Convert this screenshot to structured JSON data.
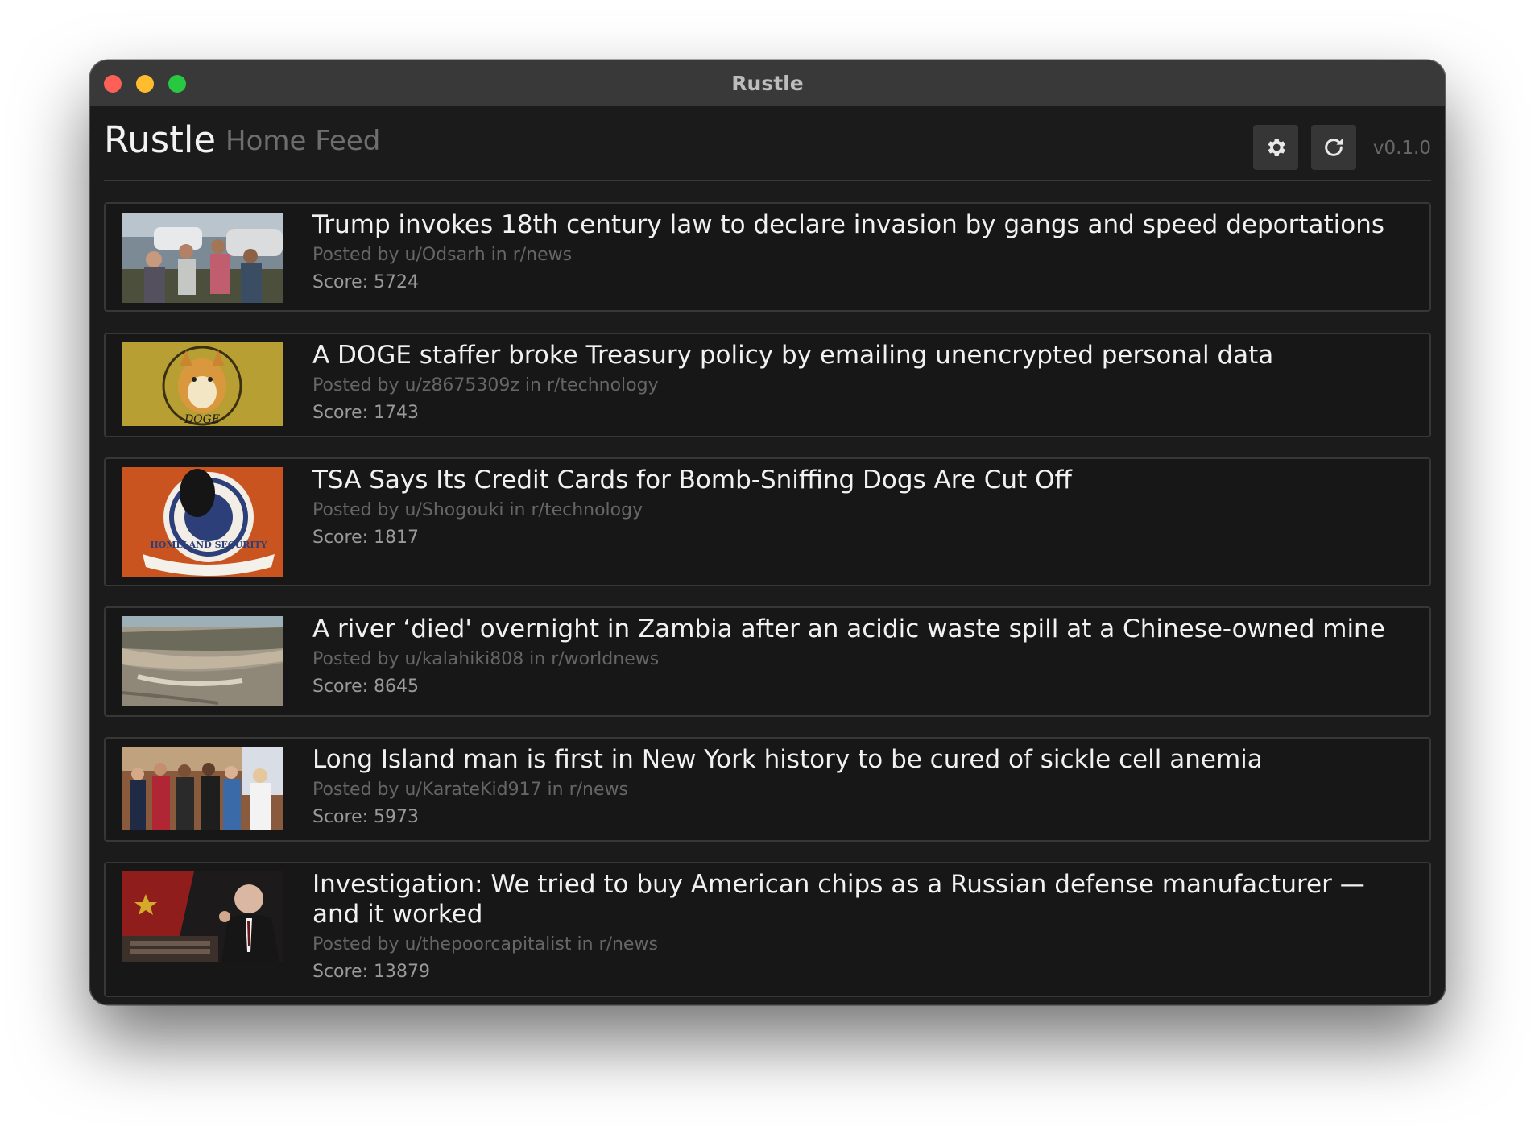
{
  "window": {
    "title": "Rustle"
  },
  "header": {
    "app_name": "Rustle",
    "subtitle": "Home Feed",
    "version": "v0.1.0"
  },
  "toolbar": {
    "settings_icon": "gear-icon",
    "refresh_icon": "refresh-icon"
  },
  "colors": {
    "background": "#1b1b1b",
    "card_border": "#373737",
    "title_text": "#f1f1f1",
    "meta_text": "#666666"
  },
  "posts": [
    {
      "title": "Trump invokes 18th century law to declare invasion by gangs and speed deportations",
      "meta": "Posted by u/Odsarh in r/news",
      "score": "Score: 5724"
    },
    {
      "title": "A DOGE staffer broke Treasury policy by emailing unencrypted personal data",
      "meta": "Posted by u/z8675309z in r/technology",
      "score": "Score: 1743",
      "thumb_text": "DOGE"
    },
    {
      "title": "TSA Says Its Credit Cards for Bomb-Sniffing Dogs Are Cut Off",
      "meta": "Posted by u/Shogouki in r/technology",
      "score": "Score: 1817",
      "thumb_text": "HOMELAND SECURITY"
    },
    {
      "title": "A river ‘died' overnight in Zambia after an acidic waste spill at a Chinese-owned mine",
      "meta": "Posted by u/kalahiki808 in r/worldnews",
      "score": "Score: 8645"
    },
    {
      "title": "Long Island man is first in New York history to be cured of sickle cell anemia",
      "meta": "Posted by u/KarateKid917 in r/news",
      "score": "Score: 5973"
    },
    {
      "title": "Investigation: We tried to buy American chips as a Russian defense manufacturer — and it worked",
      "meta": "Posted by u/thepoorcapitalist in r/news",
      "score": "Score: 13879"
    }
  ]
}
